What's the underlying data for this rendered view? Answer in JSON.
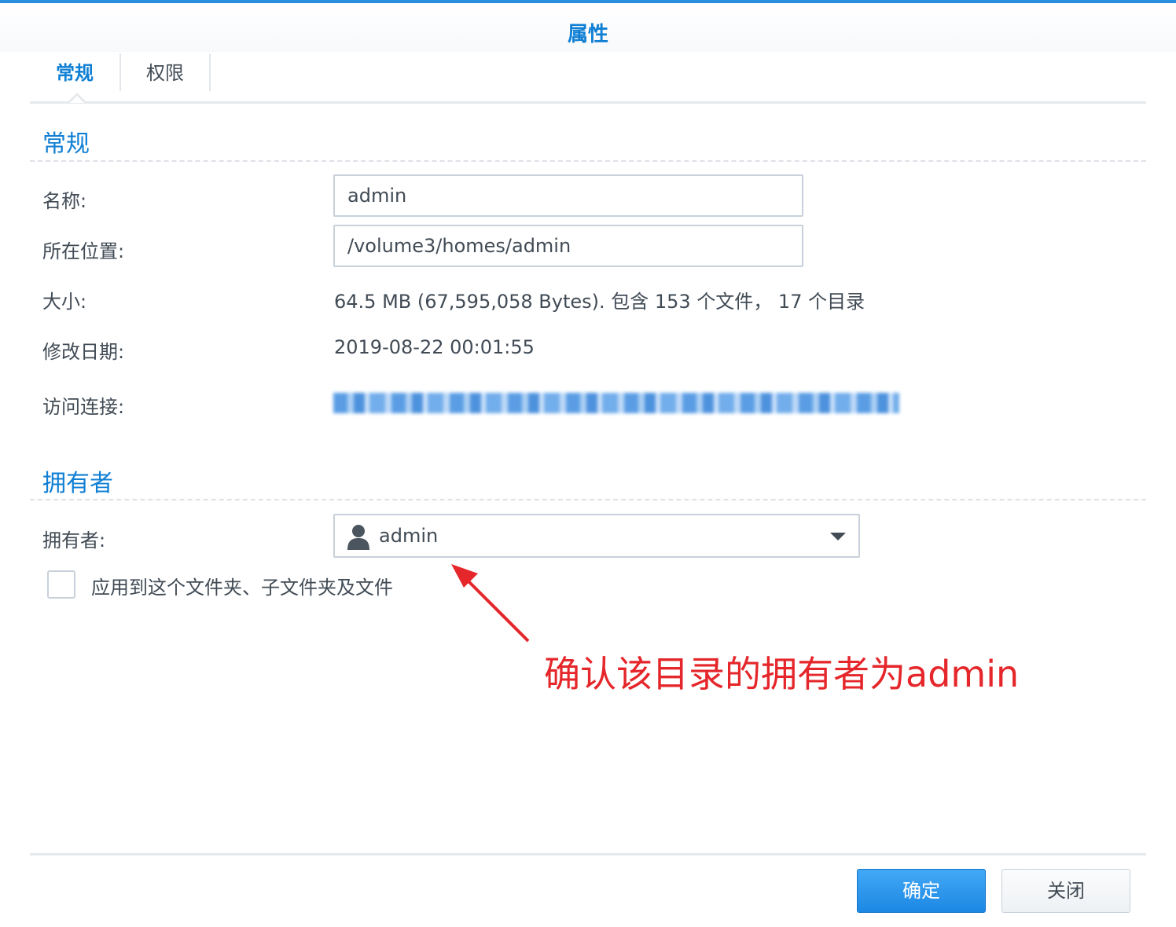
{
  "window": {
    "title": "属性",
    "accent_color": "#0f7fd4"
  },
  "tabs": [
    {
      "label": "常规",
      "active": true
    },
    {
      "label": "权限",
      "active": false
    }
  ],
  "general": {
    "section_title": "常规",
    "name_label": "名称:",
    "name_value": "admin",
    "location_label": "所在位置:",
    "location_value": "/volume3/homes/admin",
    "size_label": "大小:",
    "size_value": "64.5 MB (67,595,058 Bytes). 包含 153 个文件， 17 个目录",
    "modified_label": "修改日期:",
    "modified_value": "2019-08-22 00:01:55",
    "link_label": "访问连接:"
  },
  "owner": {
    "section_title": "拥有者",
    "owner_label": "拥有者:",
    "owner_value": "admin",
    "owner_icon": "user-icon",
    "apply_checkbox_label": "应用到这个文件夹、子文件夹及文件",
    "apply_checked": false
  },
  "annotation": {
    "text": "确认该目录的拥有者为admin",
    "color": "#e5262a"
  },
  "footer": {
    "ok_label": "确定",
    "close_label": "关闭"
  }
}
